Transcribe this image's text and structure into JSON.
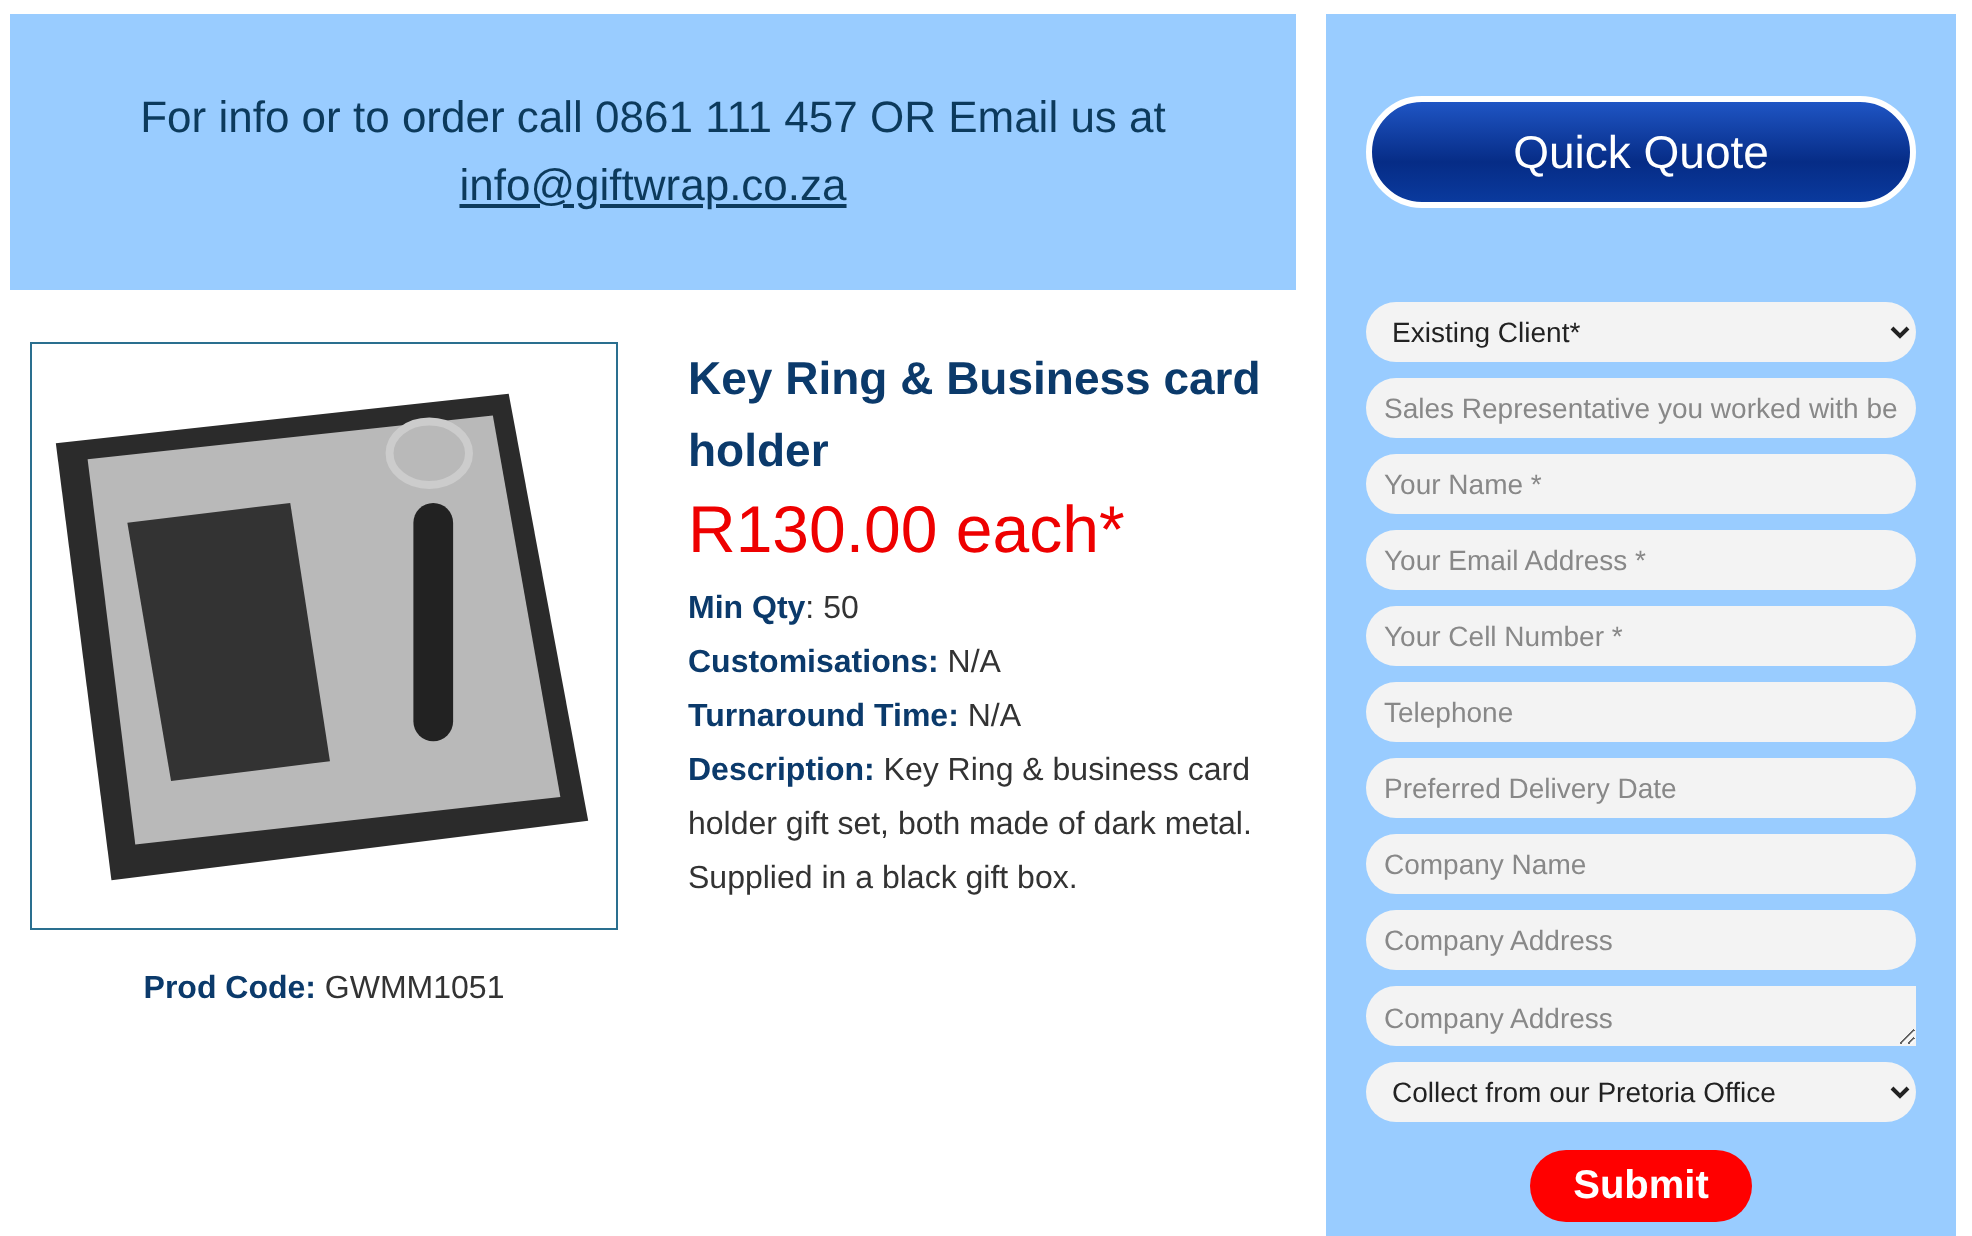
{
  "banner": {
    "text": "For info or to order call 0861 111 457 OR Email us at",
    "link": "info@giftwrap.co.za"
  },
  "product": {
    "title": "Key Ring & Business card holder",
    "price": "R130.00 each*",
    "specs": [
      "**Min Qty**: 50",
      "**Customisations:** N/A",
      "**Turnaround Time:** N/A",
      "**Description:** Key Ring & business card holder gift set, both made of dark metal."
    ],
    "note": "Supplied in a black gift box.",
    "code": "**Prod Code:** GWMM1051"
  },
  "quote_form": {
    "title": "Quick Quote",
    "fields": [
      {
        "kind": "select",
        "value": "Existing Client*"
      },
      {
        "kind": "input",
        "placeholder": "Sales Representative you worked with be"
      },
      {
        "kind": "input",
        "placeholder": "Your Name *"
      },
      {
        "kind": "input",
        "placeholder": "Your Email Address *"
      },
      {
        "kind": "input",
        "placeholder": "Your Cell Number *"
      },
      {
        "kind": "input",
        "placeholder": "Telephone"
      },
      {
        "kind": "input",
        "placeholder": "Preferred Delivery Date"
      },
      {
        "kind": "input",
        "placeholder": "Company Name"
      },
      {
        "kind": "input",
        "placeholder": "Company Address"
      },
      {
        "kind": "textarea",
        "placeholder": "Company Address"
      },
      {
        "kind": "select",
        "value": "Collect from our Pretoria Office"
      }
    ],
    "submit": "Submit"
  }
}
